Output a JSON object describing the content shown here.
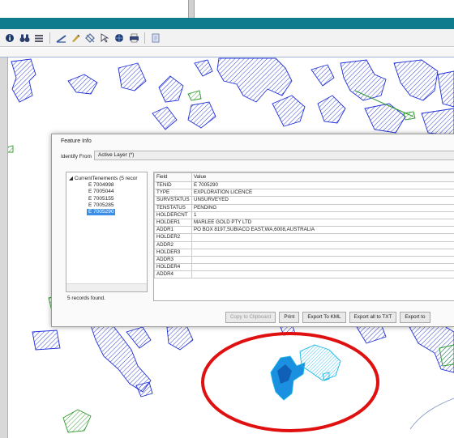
{
  "toolbar": {
    "icons": [
      "info-icon",
      "binoculars-icon",
      "layers-icon",
      "measure-icon",
      "draw-icon",
      "clear-graphics-icon",
      "select-icon",
      "globe-icon",
      "print-icon",
      "export-icon"
    ]
  },
  "dialog": {
    "title": "Feature Info",
    "identify_label": "Identify From",
    "identify_value": "Active Layer (*)",
    "tree": {
      "root": "CurrentTenements (5 recor",
      "items": [
        "E 7004998",
        "E 7005044",
        "E 7005155",
        "E 7005285",
        "E 7005290"
      ],
      "selected_index": 4
    },
    "status": "5 records found.",
    "columns": [
      "Field",
      "Value"
    ],
    "rows": [
      {
        "field": "TENID",
        "value": "E 7005290"
      },
      {
        "field": "TYPE",
        "value": "EXPLORATION LICENCE"
      },
      {
        "field": "SURVSTATUS",
        "value": "UNSURVEYED"
      },
      {
        "field": "TENSTATUS",
        "value": "PENDING"
      },
      {
        "field": "HOLDERCNT",
        "value": "1"
      },
      {
        "field": "HOLDER1",
        "value": "MARLEE GOLD PTY LTD"
      },
      {
        "field": "ADDR1",
        "value": "PO BOX 8197,SUBIACO EAST,WA,6008,AUSTRALIA"
      },
      {
        "field": "HOLDER2",
        "value": ""
      },
      {
        "field": "ADDR2",
        "value": ""
      },
      {
        "field": "HOLDER3",
        "value": ""
      },
      {
        "field": "ADDR3",
        "value": ""
      },
      {
        "field": "HOLDER4",
        "value": ""
      },
      {
        "field": "ADDR4",
        "value": ""
      }
    ],
    "buttons": {
      "copy": "Copy to Clipboard",
      "print": "Print",
      "kml": "Export To KML",
      "txt": "Export all to TXT",
      "export": "Export to"
    }
  },
  "colors": {
    "title_bar": "#0e7c8c",
    "tenement_blue": "#1f2fd6",
    "tenement_green": "#2e9a2e",
    "highlight_cyan": "#19b8e6",
    "annotation_red": "#e01010",
    "selection": "#3a8ee6"
  }
}
